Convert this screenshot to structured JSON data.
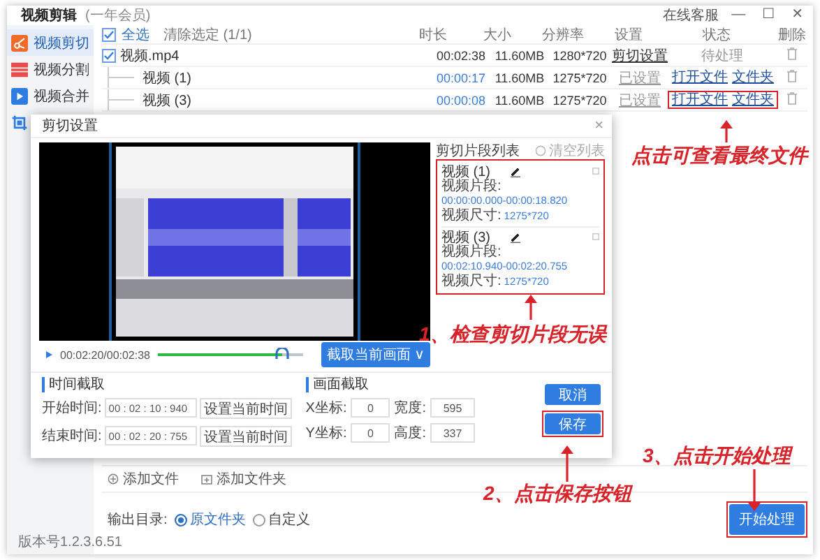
{
  "app": {
    "title": "视频剪辑",
    "membership": "(一年会员)",
    "service": "在线客服",
    "controls": [
      "—",
      "☐",
      "✕"
    ]
  },
  "sidebar": {
    "items": [
      {
        "label": "视频剪切",
        "selected": true
      },
      {
        "label": "视频分割",
        "selected": false
      },
      {
        "label": "视频合并",
        "selected": false
      },
      {
        "selected": false
      }
    ],
    "version": "版本号1.2.3.6.51"
  },
  "file_list": {
    "select_all": {
      "label": "全选",
      "checked": true
    },
    "clear": "清除选定 (1/1)",
    "columns": [
      "时长",
      "大小",
      "分辨率",
      "设置",
      "状态",
      "删除"
    ],
    "rows": [
      {
        "name": "视频.mp4",
        "checked": true,
        "duration": "00:02:38",
        "size": "11.60MB",
        "resolution": "1280*720",
        "setting": "剪切设置",
        "status": "待处理",
        "children": [
          {
            "name": "视频 (1)",
            "duration": "00:00:17",
            "size": "11.60MB",
            "resolution": "1275*720",
            "setting": "已设置",
            "actions": [
              "打开文件",
              "文件夹"
            ],
            "highlighted": false
          },
          {
            "name": "视频 (3)",
            "duration": "00:00:08",
            "size": "11.60MB",
            "resolution": "1275*720",
            "setting": "已设置",
            "actions": [
              "打开文件",
              "文件夹"
            ],
            "highlighted": true
          }
        ]
      }
    ]
  },
  "footer": {
    "add_file": "添加文件",
    "add_folder": "添加文件夹",
    "output_label": "输出目录:",
    "output_options": [
      {
        "label": "原文件夹",
        "selected": true
      },
      {
        "label": "自定义",
        "selected": false
      }
    ],
    "start": {
      "label": "开始处理",
      "highlighted": true
    }
  },
  "dialog": {
    "title": "剪切设置",
    "close": "×",
    "time": "00:02:20/00:02:38",
    "progress": {
      "level": 0.86
    },
    "capture": "截取当前画面 ∨",
    "segments": {
      "title": "剪切片段列表",
      "clear": "清空列表",
      "highlighted": true,
      "items": [
        {
          "name": "视频 (1)",
          "range_label": "视频片段:",
          "range": "00:00:00.000-00:00:18.820",
          "size_label": "视频尺寸:",
          "size": "1275*720"
        },
        {
          "name": "视频 (3)",
          "range_label": "视频片段:",
          "range": "00:02:10.940-00:02:20.755",
          "size_label": "视频尺寸:",
          "size": "1275*720"
        }
      ]
    },
    "time_cut": {
      "title": "时间截取",
      "rows": [
        {
          "label": "开始时间:",
          "value": "00 : 02 : 10 : 940",
          "button": "设置当前时间"
        },
        {
          "label": "结束时间:",
          "value": "00 : 02 : 20 : 755",
          "button": "设置当前时间"
        }
      ]
    },
    "area_cut": {
      "title": "画面截取",
      "fields": [
        {
          "label": "X坐标:",
          "value": "0"
        },
        {
          "label": "宽度:",
          "value": "595"
        },
        {
          "label": "Y坐标:",
          "value": "0"
        },
        {
          "label": "高度:",
          "value": "337"
        }
      ]
    },
    "cancel": {
      "label": "取消"
    },
    "save": {
      "label": "保存",
      "highlighted": true
    }
  },
  "annotations": [
    {
      "text": "点击可查看最终文件"
    },
    {
      "text": "1、检查剪切片段无误"
    },
    {
      "text": "2、点击保存按钮"
    },
    {
      "text": "3、点击开始处理"
    }
  ]
}
